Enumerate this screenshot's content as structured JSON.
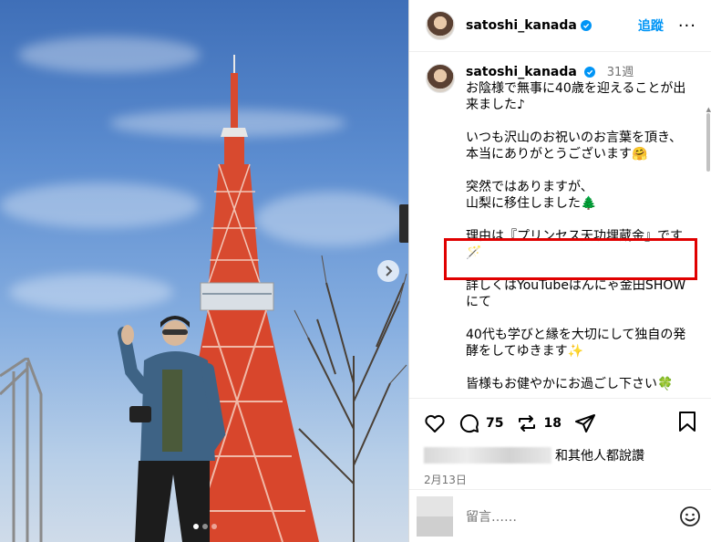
{
  "post": {
    "username": "satoshi_kanada",
    "follow_label": "追蹤",
    "more_label": "···",
    "caption": {
      "username": "satoshi_kanada",
      "time_ago": "31週",
      "paragraphs": [
        "お陰様で無事に40歳を迎えることが出来ました♪",
        "いつも沢山のお祝いのお言葉を頂き、\n本当にありがとうございます🤗",
        "突然ではありますが、\n山梨に移住しました🌲",
        "理由は『プリンセス天功埋蔵金』です🪄",
        "詳しくはYouTubeはんにゃ金田SHOWにて",
        "40代も学びと縁を大切にして独自の発酵をしてゆきます✨",
        "皆様もお健やかにお過ごし下さい🍀"
      ]
    },
    "actions": {
      "comments_count": "75",
      "reposts_count": "18"
    },
    "likes_text": "和其他人都說讚",
    "date": "2月13日",
    "comment_placeholder": "留言……"
  },
  "colors": {
    "accent": "#0095f6",
    "highlight": "#e00000"
  },
  "icons": [
    "verified-badge-icon",
    "heart-icon",
    "comment-icon",
    "repost-icon",
    "share-icon",
    "bookmark-icon",
    "emoji-icon",
    "next-arrow-icon"
  ]
}
